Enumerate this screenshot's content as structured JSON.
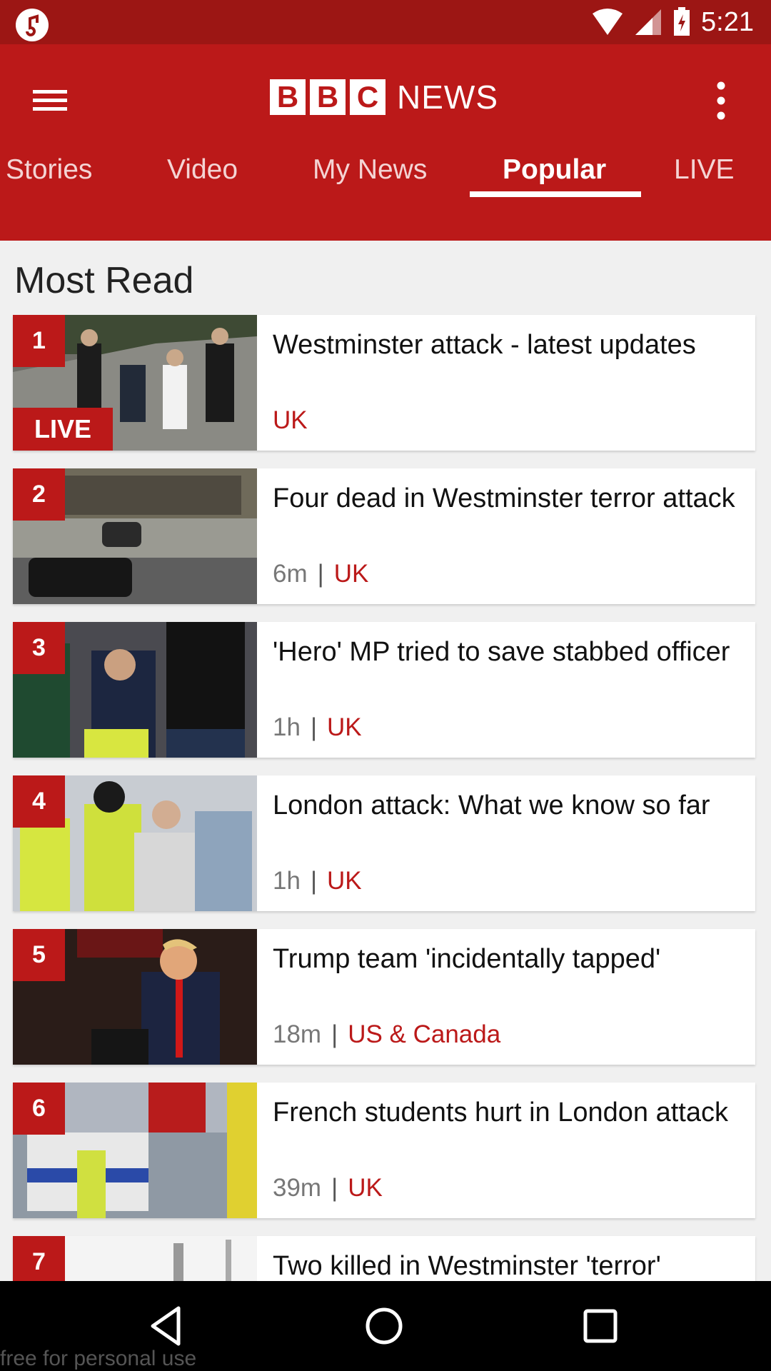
{
  "status_bar": {
    "time": "5:21"
  },
  "app_bar": {
    "brand_letters": [
      "B",
      "B",
      "C"
    ],
    "brand_news": "NEWS",
    "tabs": [
      "Stories",
      "Video",
      "My News",
      "Popular",
      "LIVE"
    ],
    "active_tab": "Popular"
  },
  "section": {
    "title": "Most Read"
  },
  "articles": [
    {
      "rank": "1",
      "title": "Westminster attack - latest updates",
      "time": "",
      "category": "UK",
      "badge": "LIVE"
    },
    {
      "rank": "2",
      "title": "Four dead in Westminster terror attack",
      "time": "6m",
      "category": "UK"
    },
    {
      "rank": "3",
      "title": "'Hero' MP tried to save stabbed officer",
      "time": "1h",
      "category": "UK"
    },
    {
      "rank": "4",
      "title": "London attack: What we know so far",
      "time": "1h",
      "category": "UK"
    },
    {
      "rank": "5",
      "title": "Trump team 'incidentally tapped'",
      "time": "18m",
      "category": "US & Canada"
    },
    {
      "rank": "6",
      "title": "French students hurt in London attack",
      "time": "39m",
      "category": "UK"
    },
    {
      "rank": "7",
      "title": "Two killed in Westminster 'terror'",
      "time": "",
      "category": ""
    }
  ],
  "meta_separator": "|",
  "watermark": "free for personal use",
  "colors": {
    "brand_red": "#bb1919",
    "status_red": "#9c1614"
  }
}
